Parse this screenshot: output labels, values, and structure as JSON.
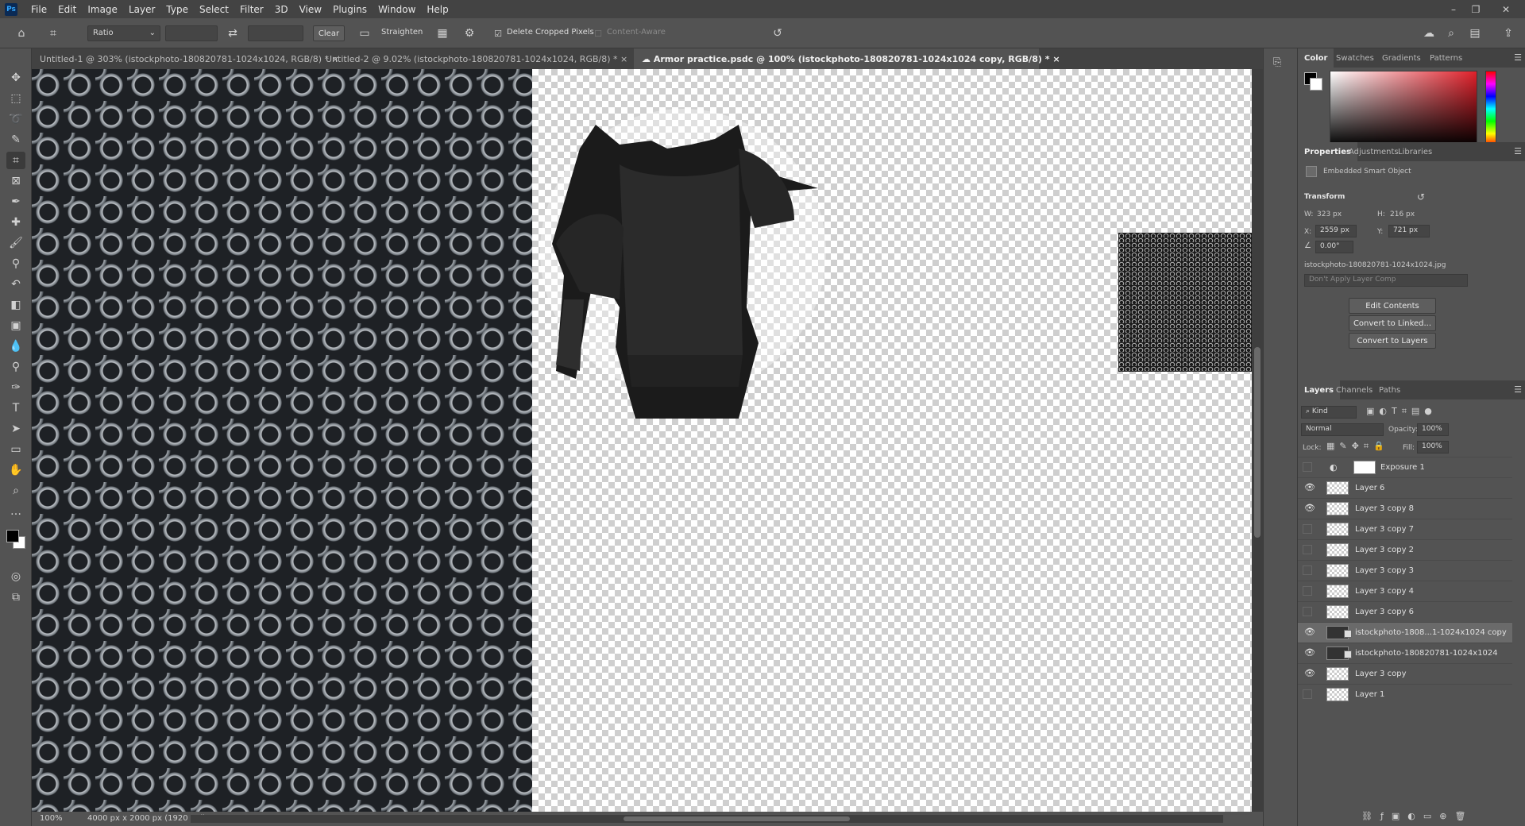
{
  "app": {
    "logo": "Ps"
  },
  "menu": [
    "File",
    "Edit",
    "Image",
    "Layer",
    "Type",
    "Select",
    "Filter",
    "3D",
    "View",
    "Plugins",
    "Window",
    "Help"
  ],
  "window_controls": {
    "minimize": "–",
    "restore": "❐",
    "close": "✕"
  },
  "options": {
    "ratio_label": "Ratio",
    "width_value": "",
    "height_value": "",
    "clear_label": "Clear",
    "straighten_label": "Straighten",
    "delete_cropped_label": "Delete Cropped Pixels",
    "delete_cropped_checked": true,
    "content_aware_label": "Content-Aware",
    "content_aware_checked": false
  },
  "tabs": [
    {
      "label": "Untitled-1 @ 303% (istockphoto-180820781-1024x1024, RGB/8) *",
      "close": "×",
      "active": false
    },
    {
      "label": "Untitled-2 @ 9.02% (istockphoto-180820781-1024x1024, RGB/8) *",
      "close": "×",
      "active": false
    },
    {
      "label": "Armor practice.psdc @ 100% (istockphoto-180820781-1024x1024 copy, RGB/8) *",
      "close": "×",
      "active": true
    }
  ],
  "status": {
    "zoom": "100%",
    "doc_info": "4000 px x 2000 px (1920 ppi)"
  },
  "color_panel": {
    "tabs": [
      "Color",
      "Swatches",
      "Gradients",
      "Patterns"
    ],
    "foreground": "#000000",
    "background": "#ffffff",
    "hue": "#e0202a"
  },
  "properties": {
    "tabs": [
      "Properties",
      "Adjustments",
      "Libraries"
    ],
    "object_type": "Embedded Smart Object",
    "section_title": "Transform",
    "w_label": "W:",
    "w_value": "323 px",
    "h_label": "H:",
    "h_value": "216 px",
    "x_label": "X:",
    "x_value": "2559 px",
    "y_label": "Y:",
    "y_value": "721 px",
    "angle_value": "0.00°",
    "filename": "istockphoto-180820781-1024x1024.jpg",
    "layer_comp_placeholder": "Don't Apply Layer Comp",
    "buttons": [
      "Edit Contents",
      "Convert to Linked...",
      "Convert to Layers"
    ]
  },
  "layers_panel": {
    "tabs": [
      "Layers",
      "Channels",
      "Paths"
    ],
    "filter_kind": "Kind",
    "blend_mode": "Normal",
    "opacity_label": "Opacity:",
    "opacity_value": "100%",
    "lock_label": "Lock:",
    "fill_label": "Fill:",
    "fill_value": "100%",
    "layers": [
      {
        "name": "Exposure 1",
        "visible": false,
        "selected": false
      },
      {
        "name": "Layer 6",
        "visible": true,
        "selected": false
      },
      {
        "name": "Layer 3 copy 8",
        "visible": true,
        "selected": false
      },
      {
        "name": "Layer 3 copy 7",
        "visible": false,
        "selected": false
      },
      {
        "name": "Layer 3 copy 2",
        "visible": false,
        "selected": false
      },
      {
        "name": "Layer 3 copy 3",
        "visible": false,
        "selected": false
      },
      {
        "name": "Layer 3 copy 4",
        "visible": false,
        "selected": false
      },
      {
        "name": "Layer 3 copy 6",
        "visible": false,
        "selected": false
      },
      {
        "name": "istockphoto-1808...1-1024x1024 copy",
        "visible": true,
        "selected": true
      },
      {
        "name": "istockphoto-180820781-1024x1024",
        "visible": true,
        "selected": false
      },
      {
        "name": "Layer 3 copy",
        "visible": true,
        "selected": false
      },
      {
        "name": "Layer 1",
        "visible": false,
        "selected": false
      }
    ]
  }
}
